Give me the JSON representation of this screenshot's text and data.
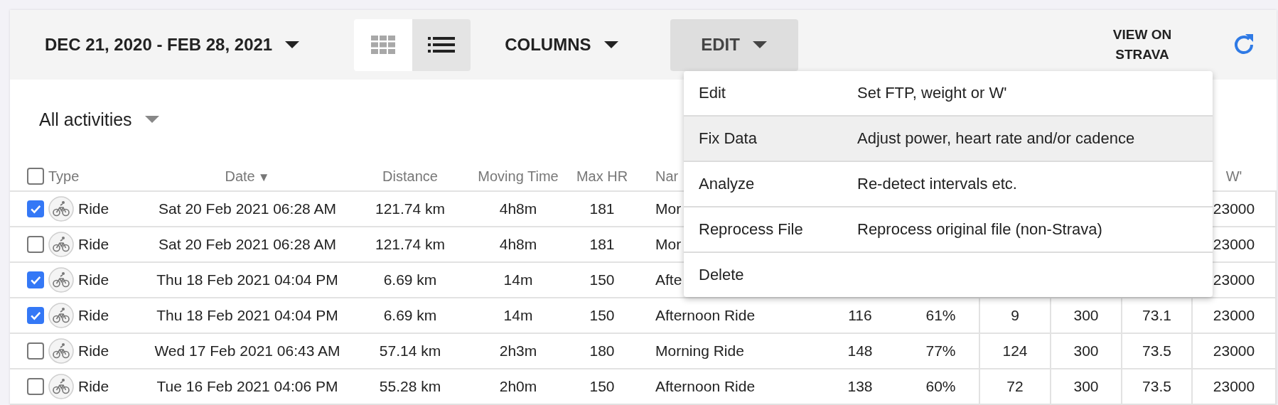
{
  "toolbar": {
    "date_range": "DEC 21, 2020 - FEB 28, 2021",
    "view_modes": [
      {
        "kind": "grid",
        "selected": false
      },
      {
        "kind": "list",
        "selected": true
      }
    ],
    "columns_button": "COLUMNS",
    "edit_button": {
      "label": "EDIT",
      "expanded": true
    },
    "view_on_strava": "VIEW ON STRAVA"
  },
  "filter": {
    "label": "All activities"
  },
  "edit_menu": [
    {
      "label": "Edit",
      "description": "Set FTP, weight or W'",
      "selected": false
    },
    {
      "label": "Fix Data",
      "description": "Adjust power, heart rate and/or cadence",
      "selected": true
    },
    {
      "label": "Analyze",
      "description": "Re-detect intervals etc.",
      "selected": false
    },
    {
      "label": "Reprocess File",
      "description": "Reprocess original file (non-Strava)",
      "selected": false
    },
    {
      "label": "Delete",
      "selected": false
    }
  ],
  "table": {
    "select_all_checked": false,
    "columns": {
      "type": "Type",
      "date": "Date",
      "date_sort_indicator": "▼",
      "distance": "Distance",
      "moving_time": "Moving Time",
      "max_hr": "Max HR",
      "name": "Nar",
      "w_prime": "W'"
    },
    "rows": [
      {
        "checked": true,
        "type": "Ride",
        "date": "Sat 20 Feb 2021 06:28 AM",
        "distance": "121.74 km",
        "moving_time": "4h8m",
        "max_hr": "181",
        "name": "Mor",
        "w_prime": "23000"
      },
      {
        "checked": false,
        "type": "Ride",
        "date": "Sat 20 Feb 2021 06:28 AM",
        "distance": "121.74 km",
        "moving_time": "4h8m",
        "max_hr": "181",
        "name": "Mor",
        "w_prime": "23000"
      },
      {
        "checked": true,
        "type": "Ride",
        "date": "Thu 18 Feb 2021 04:04 PM",
        "distance": "6.69 km",
        "moving_time": "14m",
        "max_hr": "150",
        "name": "Afte",
        "w_prime": "23000"
      },
      {
        "checked": true,
        "type": "Ride",
        "date": "Thu 18 Feb 2021 04:04 PM",
        "distance": "6.69 km",
        "moving_time": "14m",
        "max_hr": "150",
        "name": "Afternoon Ride",
        "column_7": "116",
        "column_8": "61%",
        "column_9": "9",
        "column_10": "300",
        "column_11": "73.1",
        "w_prime": "23000"
      },
      {
        "checked": false,
        "type": "Ride",
        "date": "Wed 17 Feb 2021 06:43 AM",
        "distance": "57.14 km",
        "moving_time": "2h3m",
        "max_hr": "180",
        "name": "Morning Ride",
        "column_7": "148",
        "column_8": "77%",
        "column_9": "124",
        "column_10": "300",
        "column_11": "73.5",
        "w_prime": "23000"
      },
      {
        "checked": false,
        "type": "Ride",
        "date": "Tue 16 Feb 2021 04:06 PM",
        "distance": "55.28 km",
        "moving_time": "2h0m",
        "max_hr": "150",
        "name": "Afternoon Ride",
        "column_7": "138",
        "column_8": "60%",
        "column_9": "72",
        "column_10": "300",
        "column_11": "73.5",
        "w_prime": "23000"
      }
    ]
  }
}
